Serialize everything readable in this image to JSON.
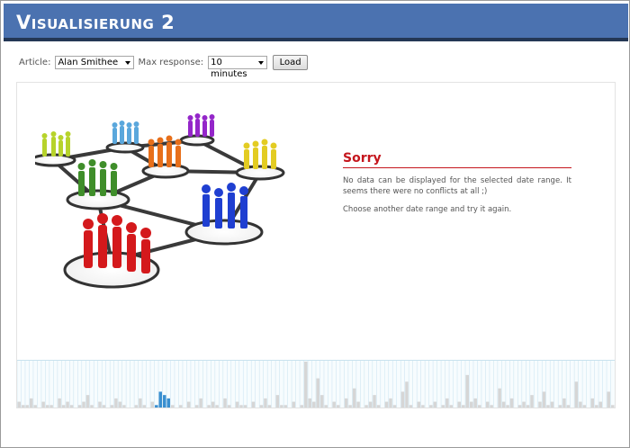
{
  "header": {
    "title": "Visualisierung 2"
  },
  "controls": {
    "article_label": "Article:",
    "article_value": "Alan Smithee",
    "response_label": "Max response:",
    "response_value": "10 minutes",
    "load_label": "Load"
  },
  "message": {
    "title": "Sorry",
    "line1": "No data can be displayed for the selected date range. It seems there were no conflicts at all ;)",
    "line2": "Choose another date range and try it again."
  },
  "colors": {
    "header_bg": "#4b72b0",
    "header_border": "#243755",
    "accent_red": "#c5161d",
    "timeline_bar": "#d6d6d6",
    "timeline_selected": "#3a8fd0",
    "timeline_grid": "#cfe6f2"
  },
  "illustration": {
    "icon": "social-network-people-icon",
    "groups": [
      "yellow-green",
      "light-blue",
      "purple",
      "orange",
      "yellow",
      "green",
      "blue",
      "red"
    ]
  },
  "timeline": {
    "bars": [
      2,
      1,
      1,
      3,
      1,
      0,
      2,
      1,
      1,
      0,
      3,
      1,
      2,
      1,
      0,
      1,
      2,
      4,
      1,
      0,
      2,
      1,
      0,
      1,
      3,
      2,
      1,
      0,
      0,
      1,
      3,
      1,
      0,
      2,
      1,
      5,
      4,
      3,
      1,
      0,
      1,
      0,
      2,
      0,
      1,
      3,
      0,
      1,
      2,
      1,
      0,
      3,
      1,
      0,
      2,
      1,
      1,
      0,
      2,
      0,
      1,
      3,
      1,
      0,
      4,
      1,
      1,
      0,
      2,
      0,
      1,
      14,
      3,
      2,
      9,
      4,
      1,
      0,
      2,
      1,
      0,
      3,
      1,
      6,
      2,
      0,
      1,
      2,
      4,
      1,
      0,
      2,
      3,
      1,
      0,
      5,
      8,
      1,
      0,
      2,
      1,
      0,
      1,
      2,
      0,
      1,
      3,
      1,
      0,
      2,
      1,
      10,
      2,
      3,
      1,
      0,
      2,
      1,
      0,
      6,
      2,
      1,
      3,
      0,
      1,
      2,
      1,
      4,
      0,
      2,
      5,
      1,
      2,
      0,
      1,
      3,
      1,
      0,
      8,
      2,
      1,
      0,
      3,
      1,
      2,
      0,
      5,
      1
    ],
    "selected_range": [
      34,
      37
    ]
  }
}
